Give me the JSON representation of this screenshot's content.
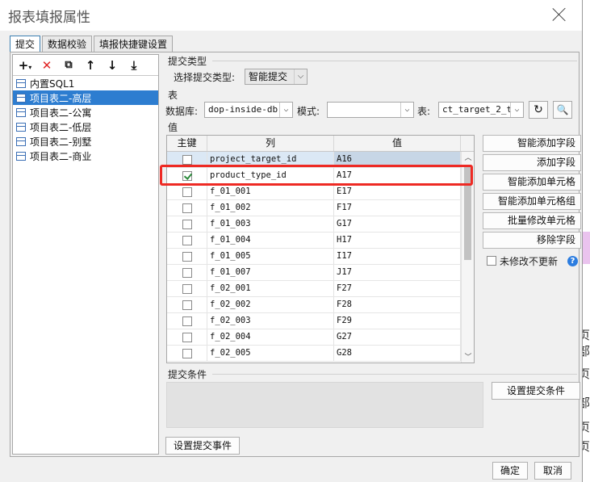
{
  "dialog": {
    "title": "报表填报属性",
    "tabs": [
      {
        "label": "提交",
        "active": true
      },
      {
        "label": "数据校验",
        "active": false
      },
      {
        "label": "填报快捷键设置",
        "active": false
      }
    ]
  },
  "tree": {
    "toolbar_icons": [
      "add-icon",
      "delete-icon",
      "copy-icon",
      "move-up-icon",
      "move-down-icon",
      "move-bottom-icon"
    ],
    "items": [
      {
        "label": "内置SQL1",
        "selected": false
      },
      {
        "label": "项目表二-高层",
        "selected": true
      },
      {
        "label": "项目表二-公寓",
        "selected": false
      },
      {
        "label": "项目表二-低层",
        "selected": false
      },
      {
        "label": "项目表二-别墅",
        "selected": false
      },
      {
        "label": "项目表二-商业",
        "selected": false
      }
    ]
  },
  "submit_type": {
    "section_label": "提交类型",
    "field_label": "选择提交类型:",
    "value": "智能提交"
  },
  "table_section": {
    "section_label": "表",
    "db_label": "数据库:",
    "db_value": "dop-inside-db",
    "schema_label": "模式:",
    "schema_value": "",
    "table_label": "表:",
    "table_value": "ct_target_2_t"
  },
  "value_section": {
    "section_label": "值",
    "columns": [
      "主键",
      "列",
      "值"
    ],
    "rows": [
      {
        "key": false,
        "col": "project_target_id",
        "val": "A16"
      },
      {
        "key": true,
        "col": "product_type_id",
        "val": "A17"
      },
      {
        "key": false,
        "col": "f_01_001",
        "val": "E17"
      },
      {
        "key": false,
        "col": "f_01_002",
        "val": "F17"
      },
      {
        "key": false,
        "col": "f_01_003",
        "val": "G17"
      },
      {
        "key": false,
        "col": "f_01_004",
        "val": "H17"
      },
      {
        "key": false,
        "col": "f_01_005",
        "val": "I17"
      },
      {
        "key": false,
        "col": "f_01_007",
        "val": "J17"
      },
      {
        "key": false,
        "col": "f_02_001",
        "val": "F27"
      },
      {
        "key": false,
        "col": "f_02_002",
        "val": "F28"
      },
      {
        "key": false,
        "col": "f_02_003",
        "val": "F29"
      },
      {
        "key": false,
        "col": "f_02_004",
        "val": "G27"
      },
      {
        "key": false,
        "col": "f_02_005",
        "val": "G28"
      }
    ]
  },
  "side_buttons": {
    "smart_add_field": "智能添加字段",
    "add_field": "添加字段",
    "smart_add_cell": "智能添加单元格",
    "smart_add_cell_group": "智能添加单元格组",
    "batch_modify_cell": "批量修改单元格",
    "remove_field": "移除字段",
    "no_update_unmodified": "未修改不更新"
  },
  "submit_condition": {
    "section_label": "提交条件",
    "set_button": "设置提交条件"
  },
  "footer": {
    "set_event_button": "设置提交事件",
    "ok": "确定",
    "cancel": "取消"
  },
  "background": {
    "side_text": [
      "页",
      "部",
      "页",
      "部",
      "页",
      "页"
    ]
  },
  "colors": {
    "selection": "#2d7dd0",
    "highlight_border": "#ee2a24",
    "help_icon": "#2c7de0"
  }
}
